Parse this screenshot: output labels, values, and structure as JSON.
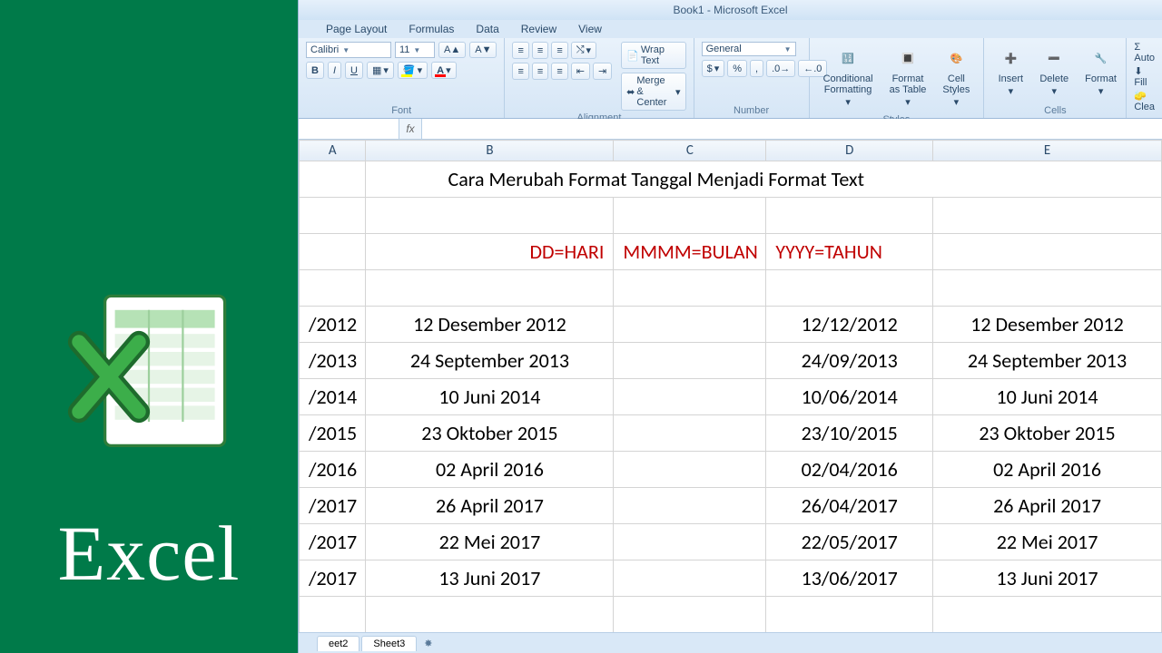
{
  "left": {
    "word": "Excel"
  },
  "window": {
    "title": "Book1 - Microsoft Excel"
  },
  "menu": [
    "Page Layout",
    "Formulas",
    "Data",
    "Review",
    "View"
  ],
  "ribbon": {
    "font": {
      "title": "Font",
      "family": "Calibri",
      "size": "11",
      "bold": "B",
      "italic": "I",
      "underline": "U"
    },
    "alignment": {
      "title": "Alignment",
      "wrap": "Wrap Text",
      "merge": "Merge & Center"
    },
    "number": {
      "title": "Number",
      "format": "General"
    },
    "styles": {
      "title": "Styles",
      "cond": "Conditional\nFormatting",
      "table": "Format\nas Table",
      "cell": "Cell\nStyles"
    },
    "cells": {
      "title": "Cells",
      "insert": "Insert",
      "delete": "Delete",
      "format": "Format"
    },
    "editing": {
      "auto": "Auto",
      "fill": "Fill",
      "clear": "Clea"
    }
  },
  "columns": [
    "A",
    "B",
    "C",
    "D",
    "E"
  ],
  "sheet": {
    "title": "Cara Merubah Format Tanggal Menjadi Format Text",
    "legend": {
      "b": "DD=HARI",
      "c": "MMMM=BULAN",
      "d": "YYYY=TAHUN"
    },
    "rows": [
      {
        "a": "/2012",
        "b": "12 Desember 2012",
        "d": "12/12/2012",
        "e": "12 Desember 2012"
      },
      {
        "a": "/2013",
        "b": "24 September 2013",
        "d": "24/09/2013",
        "e": "24 September 2013"
      },
      {
        "a": "/2014",
        "b": "10 Juni 2014",
        "d": "10/06/2014",
        "e": "10 Juni 2014"
      },
      {
        "a": "/2015",
        "b": "23 Oktober 2015",
        "d": "23/10/2015",
        "e": "23 Oktober 2015"
      },
      {
        "a": "/2016",
        "b": "02 April 2016",
        "d": "02/04/2016",
        "e": "02 April 2016"
      },
      {
        "a": "/2017",
        "b": "26 April 2017",
        "d": "26/04/2017",
        "e": "26 April 2017"
      },
      {
        "a": "/2017",
        "b": "22 Mei 2017",
        "d": "22/05/2017",
        "e": "22 Mei 2017"
      },
      {
        "a": "/2017",
        "b": "13 Juni 2017",
        "d": "13/06/2017",
        "e": "13 Juni 2017"
      }
    ]
  },
  "tabs": {
    "t2": "eet2",
    "t3": "Sheet3"
  }
}
